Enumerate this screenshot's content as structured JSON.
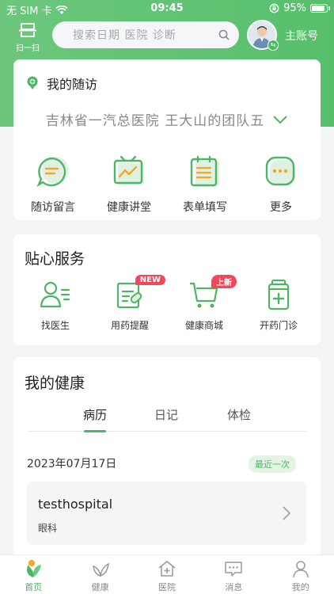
{
  "status_bar": {
    "carrier": "无 SIM 卡",
    "time": "09:45",
    "battery": "95%",
    "battery_level": 0.95
  },
  "header": {
    "scan_label": "扫一扫",
    "search_placeholder": "搜索日期  医院  诊断",
    "account_label": "主账号"
  },
  "follow_up": {
    "title": "我的随访",
    "hospital_team": "吉林省一汽总医院  王大山的团队五",
    "actions": [
      {
        "label": "随访留言",
        "icon": "message-icon"
      },
      {
        "label": "健康讲堂",
        "icon": "tv-chart-icon"
      },
      {
        "label": "表单填写",
        "icon": "form-icon"
      },
      {
        "label": "更多",
        "icon": "more-icon"
      }
    ]
  },
  "services": {
    "title": "贴心服务",
    "items": [
      {
        "label": "找医生",
        "icon": "doctor-icon",
        "badge": ""
      },
      {
        "label": "用药提醒",
        "icon": "medication-reminder-icon",
        "badge": "NEW"
      },
      {
        "label": "健康商城",
        "icon": "cart-icon",
        "badge": "上新"
      },
      {
        "label": "开药门诊",
        "icon": "prescription-icon",
        "badge": ""
      }
    ]
  },
  "health": {
    "title": "我的健康",
    "tabs": [
      "病历",
      "日记",
      "体检"
    ],
    "active_tab": 0,
    "record_date": "2023年07月17日",
    "recent_badge": "最近一次",
    "record": {
      "hospital": "testhospital",
      "department": "眼科"
    }
  },
  "tab_bar": {
    "items": [
      {
        "label": "首页",
        "icon": "home-logo-icon",
        "active": true
      },
      {
        "label": "健康",
        "icon": "leaf-icon",
        "active": false
      },
      {
        "label": "医院",
        "icon": "hospital-icon",
        "active": false
      },
      {
        "label": "消息",
        "icon": "message-bubble-icon",
        "active": false
      },
      {
        "label": "我的",
        "icon": "person-icon",
        "active": false
      }
    ]
  },
  "colors": {
    "brand_green": "#4fb566",
    "badge_red": "#f0485b"
  }
}
